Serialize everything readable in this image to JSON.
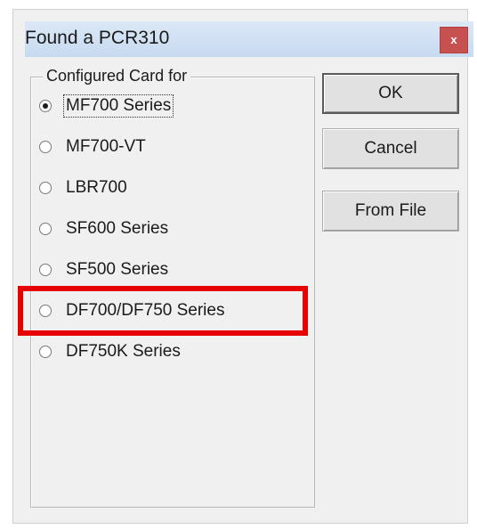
{
  "window": {
    "title": "Found a PCR310",
    "close_label": "x"
  },
  "group": {
    "label": "Configured Card for",
    "options": [
      {
        "label": "MF700 Series",
        "checked": true
      },
      {
        "label": "MF700-VT",
        "checked": false
      },
      {
        "label": "LBR700",
        "checked": false
      },
      {
        "label": "SF600 Series",
        "checked": false
      },
      {
        "label": "SF500 Series",
        "checked": false
      },
      {
        "label": "DF700/DF750 Series",
        "checked": false
      },
      {
        "label": "DF750K Series",
        "checked": false
      }
    ]
  },
  "buttons": {
    "ok": "OK",
    "cancel": "Cancel",
    "from_file": "From File"
  },
  "annotation": {
    "highlighted_option": "DF700/DF750 Series",
    "color": "#e60000"
  }
}
